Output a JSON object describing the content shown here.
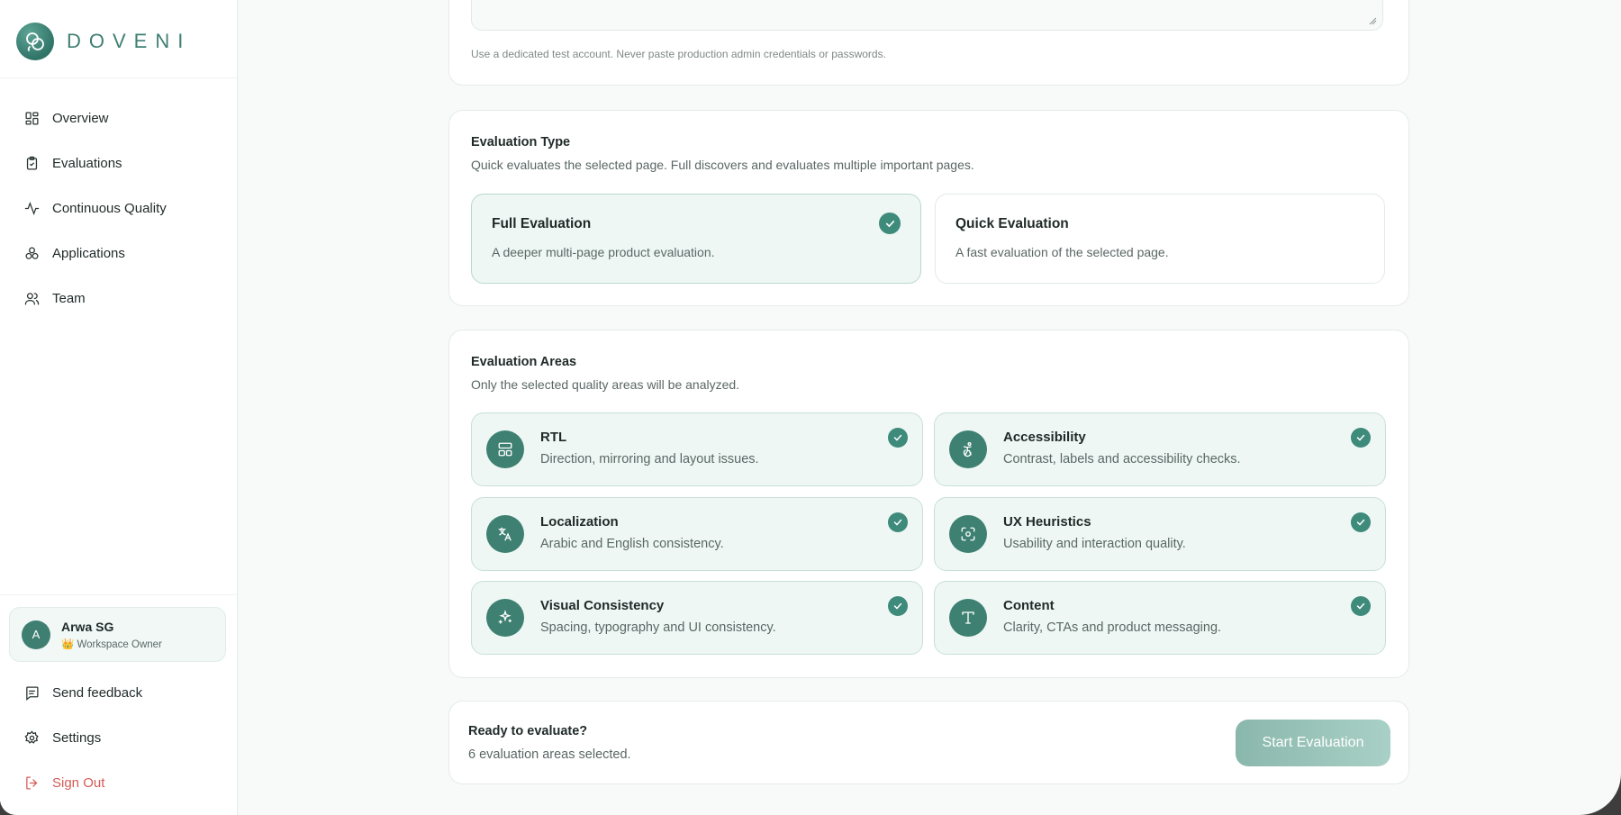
{
  "brand": {
    "name": "DOVENI"
  },
  "sidebar": {
    "items": [
      {
        "label": "Overview",
        "icon": "layout-grid-icon"
      },
      {
        "label": "Evaluations",
        "icon": "clipboard-check-icon"
      },
      {
        "label": "Continuous Quality",
        "icon": "activity-icon"
      },
      {
        "label": "Applications",
        "icon": "boxes-icon"
      },
      {
        "label": "Team",
        "icon": "users-icon"
      }
    ],
    "user": {
      "initial": "A",
      "name": "Arwa SG",
      "role": "👑 Workspace Owner"
    },
    "bottom": [
      {
        "label": "Send feedback",
        "icon": "message-square-icon"
      },
      {
        "label": "Settings",
        "icon": "gear-icon"
      },
      {
        "label": "Sign Out",
        "icon": "log-out-icon"
      }
    ]
  },
  "credentials": {
    "hint": "Use a dedicated test account. Never paste production admin credentials or passwords."
  },
  "evaluation_type": {
    "title": "Evaluation Type",
    "subtitle": "Quick evaluates the selected page. Full discovers and evaluates multiple important pages.",
    "options": [
      {
        "title": "Full Evaluation",
        "desc": "A deeper multi-page product evaluation.",
        "selected": true
      },
      {
        "title": "Quick Evaluation",
        "desc": "A fast evaluation of the selected page.",
        "selected": false
      }
    ]
  },
  "evaluation_areas": {
    "title": "Evaluation Areas",
    "subtitle": "Only the selected quality areas will be analyzed.",
    "areas": [
      {
        "title": "RTL",
        "desc": "Direction, mirroring and layout issues.",
        "icon": "layout-panel-icon",
        "selected": true
      },
      {
        "title": "Accessibility",
        "desc": "Contrast, labels and accessibility checks.",
        "icon": "accessibility-icon",
        "selected": true
      },
      {
        "title": "Localization",
        "desc": "Arabic and English consistency.",
        "icon": "languages-icon",
        "selected": true
      },
      {
        "title": "UX Heuristics",
        "desc": "Usability and interaction quality.",
        "icon": "scan-focus-icon",
        "selected": true
      },
      {
        "title": "Visual Consistency",
        "desc": "Spacing, typography and UI consistency.",
        "icon": "sparkles-icon",
        "selected": true
      },
      {
        "title": "Content",
        "desc": "Clarity, CTAs and product messaging.",
        "icon": "type-icon",
        "selected": true
      }
    ]
  },
  "footer_bar": {
    "title": "Ready to evaluate?",
    "subtitle": "6 evaluation areas selected.",
    "button": "Start Evaluation"
  },
  "colors": {
    "accent": "#3e8072",
    "danger": "#d45b55",
    "selected_bg": "#eef7f4"
  }
}
